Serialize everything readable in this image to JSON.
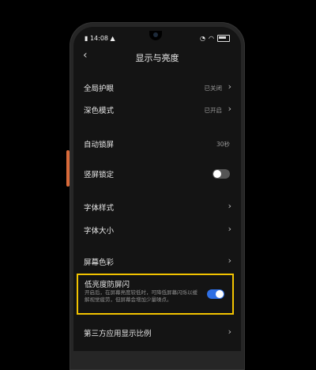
{
  "status_bar": {
    "time": "14:08",
    "time_icon": "signal-dot-icon",
    "right_icons": [
      "alarm-icon",
      "wifi-icon",
      "battery-icon"
    ]
  },
  "header": {
    "back_icon": "back-chevron-icon",
    "title": "显示与亮度"
  },
  "settings": [
    {
      "label": "全局护眼",
      "value": "已关闭",
      "control": "chevron"
    },
    {
      "label": "深色模式",
      "value": "已开启",
      "control": "chevron"
    },
    {
      "label": "自动锁屏",
      "value": "30秒",
      "control": "none"
    },
    {
      "label": "竖屏锁定",
      "value": "",
      "control": "toggle-off"
    },
    {
      "label": "字体样式",
      "value": "",
      "control": "chevron"
    },
    {
      "label": "字体大小",
      "value": "",
      "control": "chevron"
    },
    {
      "label": "屏幕色彩",
      "value": "",
      "control": "chevron"
    }
  ],
  "highlight_item": {
    "label": "低亮度防屏闪",
    "description": "开启后，在屏幕亮度较低时，可降低屏幕闪烁以缓解视觉疲劳，但屏幕会增加少量噪点。",
    "toggle_on": true,
    "highlight_color": "#f2c300"
  },
  "last_item": {
    "label": "第三方应用显示比例",
    "control": "chevron"
  },
  "colors": {
    "toggle_on": "#2f6fe4",
    "toggle_off": "#555555",
    "accent_side_button": "#d86a3a"
  }
}
